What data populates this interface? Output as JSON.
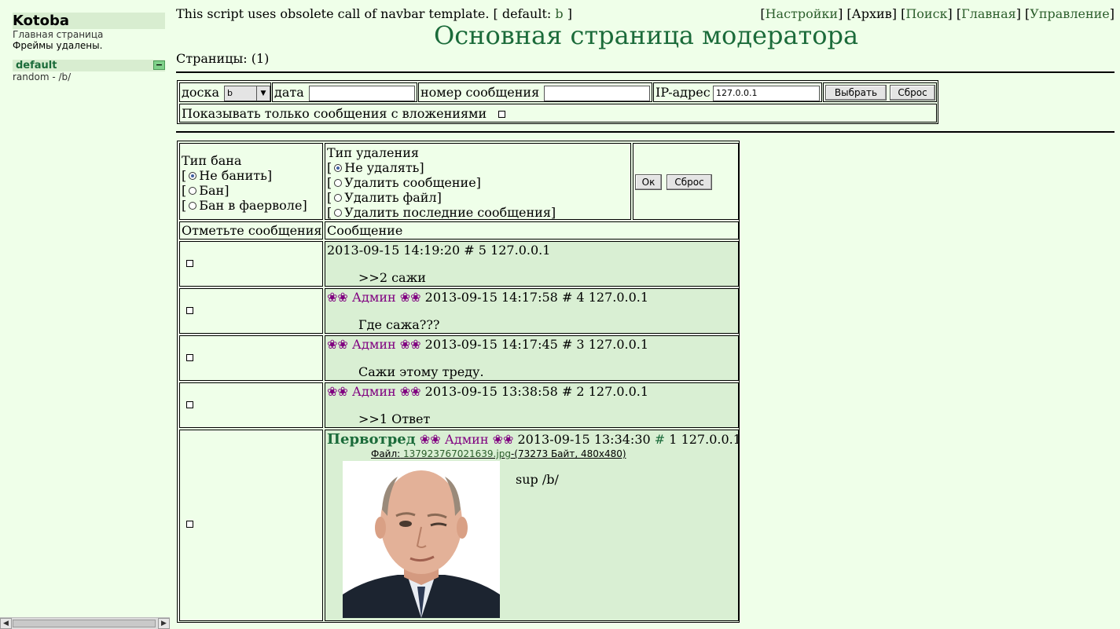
{
  "sidebar": {
    "title": "Kotoba",
    "main_page": "Главная страница",
    "frames_removed": "Фреймы удалены.",
    "category": "default",
    "toggle": "−",
    "board_link": "random - /b/"
  },
  "header": {
    "notice_prefix": "This script uses obsolete call of navbar template. [ default:",
    "notice_board": "b",
    "notice_suffix": "]",
    "nav": {
      "settings": "Настройки",
      "archive": "Архив",
      "search": "Поиск",
      "home": "Главная",
      "manage": "Управление"
    },
    "title": "Основная страница модератора",
    "pages": "Страницы: (1)"
  },
  "filter": {
    "board_label": "доска",
    "board_value": "b",
    "date_label": "дата",
    "date_value": "",
    "msgnum_label": "номер сообщения",
    "msgnum_value": "",
    "ip_label": "IP-адрес",
    "ip_value": "127.0.0.1",
    "select_button": "Выбрать",
    "reset_button": "Сброс",
    "attachments_only": "Показывать только сообщения с вложениями"
  },
  "actions": {
    "ban_type_label": "Тип бана",
    "ban_options": [
      "Не банить]",
      "Бан]",
      "Бан в фаерволе]"
    ],
    "delete_type_label": "Тип удаления",
    "delete_options": [
      "Не удалять]",
      "Удалить сообщение]",
      "Удалить файл]",
      "Удалить последние сообщения]"
    ],
    "ok_button": "Ок",
    "reset_button": "Сброс",
    "col_mark": "Отметьте сообщения",
    "col_message": "Сообщение"
  },
  "posts": [
    {
      "name": "",
      "datetime": "2013-09-15 14:19:20",
      "num": "# 5",
      "ip": "127.0.0.1",
      "text": ">>2 сажи"
    },
    {
      "name": "❀❀ Админ ❀❀",
      "datetime": "2013-09-15 14:17:58",
      "num": "# 4",
      "ip": "127.0.0.1",
      "text": "Где сажа???"
    },
    {
      "name": "❀❀ Админ ❀❀",
      "datetime": "2013-09-15 14:17:45",
      "num": "# 3",
      "ip": "127.0.0.1",
      "text": "Сажи этому треду."
    },
    {
      "name": "❀❀ Админ ❀❀",
      "datetime": "2013-09-15 13:38:58",
      "num": "# 2",
      "ip": "127.0.0.1",
      "text": ">>1 Ответ"
    }
  ],
  "op": {
    "subject": "Первотред",
    "name": "❀❀ Админ ❀❀",
    "datetime": "2013-09-15 13:34:30",
    "hash": "#",
    "num": "1",
    "ip": "127.0.0.1",
    "file_label": "Файл:",
    "file_name": "137923767021639.jpg",
    "file_meta": "-(73273 Байт, 480x480)",
    "text": "sup /b/"
  }
}
